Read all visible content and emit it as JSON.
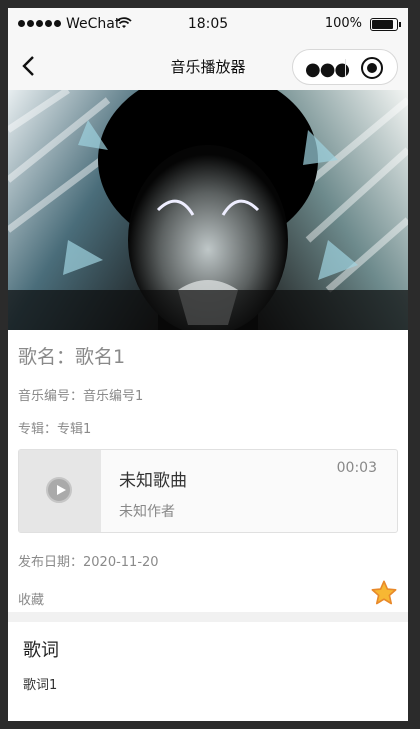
{
  "status_bar": {
    "carrier": "WeChat",
    "time": "18:05",
    "battery": "100%",
    "battery_level": 100
  },
  "nav": {
    "title": "音乐播放器",
    "back_icon": "chevron-left-icon",
    "menu_icon": "more-dots-icon",
    "close_icon": "target-icon"
  },
  "song": {
    "name": "歌名：歌名1",
    "number": "音乐编号：音乐编号1",
    "album": "专辑：专辑1",
    "release": "发布日期：2020-11-20",
    "favorite_label": "收藏"
  },
  "audio_player": {
    "title": "未知歌曲",
    "author": "未知作者",
    "time": "00:03",
    "play_icon": "play-icon"
  },
  "lyrics": {
    "heading": "歌词",
    "text": "歌词1"
  },
  "colors": {
    "star": "#f5a623",
    "nav_bg": "#f7f7f7"
  }
}
